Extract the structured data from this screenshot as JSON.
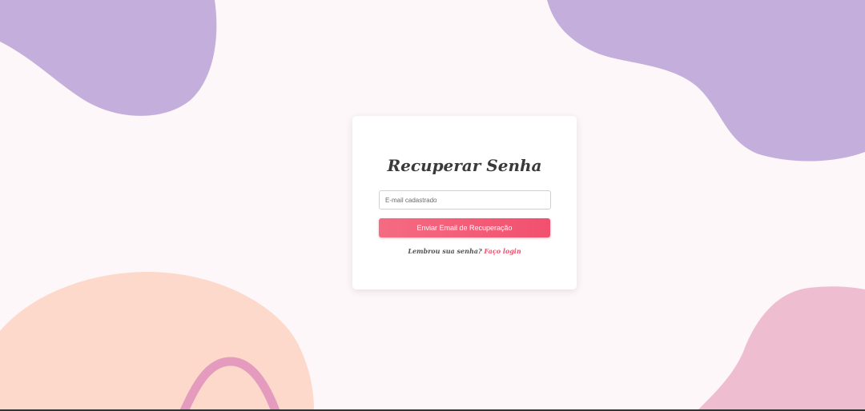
{
  "recover": {
    "title": "Recuperar Senha",
    "email_placeholder": "E-mail cadastrado",
    "email_value": "",
    "send_button_label": "Enviar Email de Recuperação",
    "remember_text": "Lembrou sua senha?",
    "login_link_label": "Faço login"
  },
  "colors": {
    "background": "#fdf7f9",
    "blob_purple": "#c4aedc",
    "blob_peach": "#fdd9cc",
    "blob_pink": "#efbdd0",
    "arch_pink": "#e59bbd",
    "accent": "#f2506e"
  }
}
